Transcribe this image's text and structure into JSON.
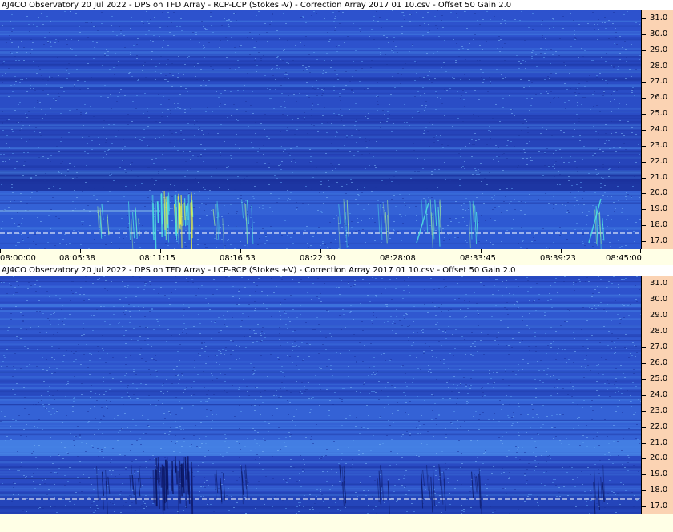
{
  "panels": [
    {
      "title": "AJ4CO Observatory 20 Jul 2022  -  DPS on TFD Array  -  RCP-LCP (Stokes -V)  -  Correction Array 2017 01 10.csv  -  Offset 50  Gain 2.0",
      "polarity": "negative"
    },
    {
      "title": "AJ4CO Observatory 20 Jul 2022  -  DPS on TFD Array  -  LCP-RCP (Stokes +V)  -  Correction Array 2017 01 10.csv  -  Offset 50  Gain 2.0",
      "polarity": "positive"
    }
  ],
  "y_axis": {
    "labels": [
      "31.0",
      "30.0",
      "29.0",
      "28.0",
      "27.0",
      "26.0",
      "25.0",
      "24.0",
      "23.0",
      "22.0",
      "21.0",
      "20.0",
      "19.0",
      "18.0",
      "17.0"
    ],
    "max": 31.5,
    "min": 16.5
  },
  "x_axis": {
    "labels": [
      "08:00:00",
      "08:05:38",
      "08:11:15",
      "08:16:53",
      "08:22:30",
      "08:28:08",
      "08:33:45",
      "08:39:23",
      "08:45:00"
    ]
  },
  "colors": {
    "background": "#ffffe6",
    "axis_bg": "#fbd3b3",
    "spectro_base": "#2c4fc8",
    "spectro_dark": "#1a2f9a",
    "spectro_light": "#4a8ae8",
    "burst_yellow": "#e6f04a",
    "burst_cyan": "#50e0e0"
  }
}
